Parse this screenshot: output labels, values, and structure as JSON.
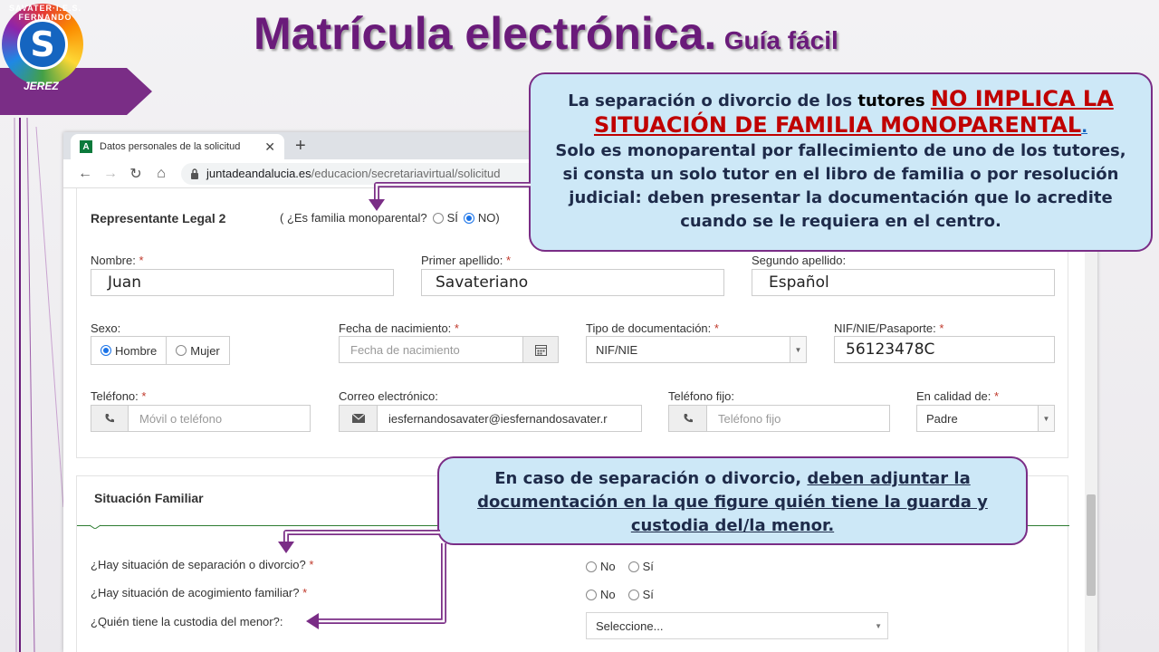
{
  "slide": {
    "title": "Matrícula electrónica.",
    "subtitle": "Guía fácil",
    "logo": {
      "ring_text": "SAVATER·I.E.S. FERNANDO",
      "letter": "S",
      "city": "JEREZ"
    }
  },
  "browser": {
    "tab_title": "Datos personales de la solicitud",
    "tab_favicon": "A",
    "tab_close": "✕",
    "new_tab": "+",
    "nav": {
      "back": "←",
      "forward": "→",
      "reload": "↻",
      "home": "⌂"
    },
    "url_domain": "juntadeandalucia.es",
    "url_path": "/educacion/secretariavirtual/solicitud"
  },
  "representante": {
    "section_title": "Representante Legal 2",
    "monoparental_question": "( ¿Es familia monoparental?",
    "monoparental_si": "SÍ",
    "monoparental_no": "NO)",
    "nombre_label": "Nombre:",
    "nombre_value": "Juan",
    "primer_apellido_label": "Primer apellido:",
    "primer_apellido_value": "Savateriano",
    "segundo_apellido_label": "Segundo apellido:",
    "segundo_apellido_value": "Español",
    "sexo_label": "Sexo:",
    "sexo_hombre": "Hombre",
    "sexo_mujer": "Mujer",
    "fecha_label": "Fecha de nacimiento:",
    "fecha_placeholder": "Fecha de nacimiento",
    "tipo_doc_label": "Tipo de documentación:",
    "tipo_doc_value": "NIF/NIE",
    "nif_label": "NIF/NIE/Pasaporte:",
    "nif_value": "56123478C",
    "telefono_label": "Teléfono:",
    "telefono_placeholder": "Móvil o teléfono",
    "correo_label": "Correo electrónico:",
    "correo_value": "iesfernandosavater@iesfernandosavater.r",
    "telefono_fijo_label": "Teléfono fijo:",
    "telefono_fijo_placeholder": "Teléfono fijo",
    "calidad_label": "En calidad de:",
    "calidad_value": "Padre",
    "required_mark": "*"
  },
  "situacion": {
    "section_title": "Situación Familiar",
    "q1": "¿Hay situación de separación o divorcio?",
    "q2": "¿Hay situación de acogimiento familiar?",
    "q3": "¿Quién tiene la custodia del menor?:",
    "no": "No",
    "si": "Sí",
    "custodia_placeholder": "Seleccione..."
  },
  "callout1": {
    "line1_a": "La separación o divorcio de los ",
    "line1_b": "tutores",
    "highlight": "NO IMPLICA LA SITUACIÓN DE FAMILIA MONOPARENTAL",
    "highlight_end": ".",
    "body": "Solo es monoparental por fallecimiento de uno de los tutores, si consta un solo tutor en el libro de familia o por resolución judicial: deben presentar la documentación que lo acredite cuando se le requiera en el centro."
  },
  "callout2": {
    "text_a": "En caso de separación o divorcio, ",
    "text_b": "deben adjuntar la documentación en la que figure quién tiene la guarda y custodia del/la menor",
    "text_end": "."
  },
  "colors": {
    "accent_purple": "#7a2d86",
    "callout_bg": "#cde8f7",
    "highlight_red": "#c00000",
    "required_red": "#c0392b",
    "section_green": "#2e7d32"
  },
  "icons": {
    "calendar": "calendar-icon",
    "phone": "phone-icon",
    "envelope": "envelope-icon",
    "lock": "lock-icon"
  }
}
